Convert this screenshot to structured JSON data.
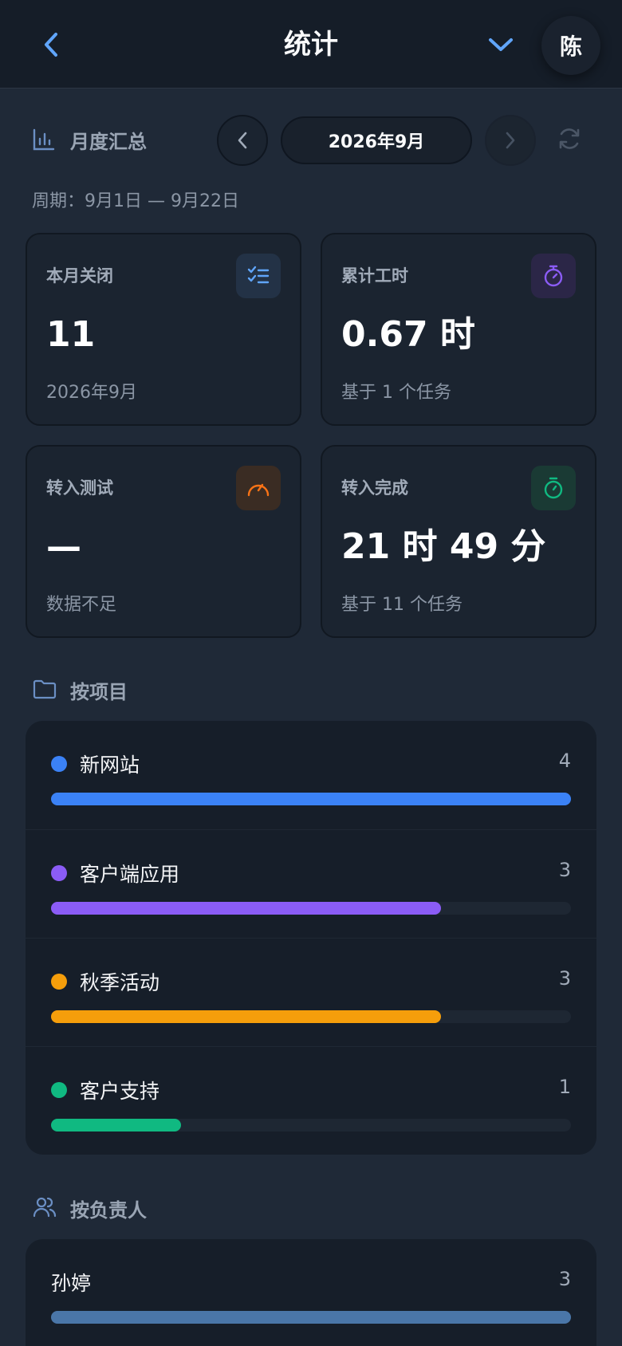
{
  "header": {
    "title": "统计",
    "avatar_text": "陈"
  },
  "summary": {
    "label": "月度汇总",
    "month": "2026年9月",
    "period": "周期：9月1日 — 9月22日"
  },
  "cards": [
    {
      "title": "本月关闭",
      "value": "11",
      "sub": "2026年9月",
      "icon": "checklist-icon",
      "color": "#60a5fa",
      "bg": "#233246"
    },
    {
      "title": "累计工时",
      "value": "0.67 时",
      "sub": "基于 1 个任务",
      "icon": "stopwatch-icon",
      "color": "#8b5cf6",
      "bg": "#2b2647"
    },
    {
      "title": "转入测试",
      "value": "—",
      "sub": "数据不足",
      "icon": "speedometer-icon",
      "color": "#f97316",
      "bg": "#3a2c23"
    },
    {
      "title": "转入完成",
      "value": "21 时 49 分",
      "sub": "基于 11 个任务",
      "icon": "timer-icon",
      "color": "#10b981",
      "bg": "#1a3a34"
    }
  ],
  "by_project": {
    "label": "按项目",
    "items": [
      {
        "name": "新网站",
        "count": "4",
        "color": "#3b82f6",
        "fraction": 1.0
      },
      {
        "name": "客户端应用",
        "count": "3",
        "color": "#8b5cf6",
        "fraction": 0.75
      },
      {
        "name": "秋季活动",
        "count": "3",
        "color": "#f59e0b",
        "fraction": 0.75
      },
      {
        "name": "客户支持",
        "count": "1",
        "color": "#10b981",
        "fraction": 0.25
      }
    ]
  },
  "by_owner": {
    "label": "按负责人",
    "items": [
      {
        "name": "孙婷",
        "count": "3",
        "color": "#4a76a8",
        "fraction": 1.0
      }
    ]
  }
}
